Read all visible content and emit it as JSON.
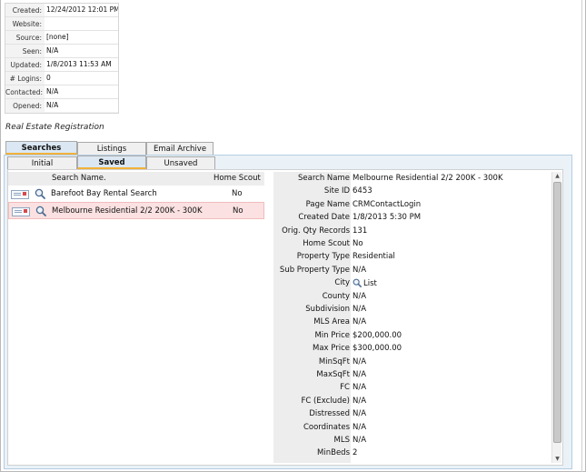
{
  "contact_info": [
    {
      "label": "Created:",
      "value": "12/24/2012 12:01 PM"
    },
    {
      "label": "Website:",
      "value": ""
    },
    {
      "label": "Source:",
      "value": "[none]"
    },
    {
      "label": "Seen:",
      "value": "N/A"
    },
    {
      "label": "Updated:",
      "value": "1/8/2013 11:53 AM"
    },
    {
      "label": "# Logins:",
      "value": "0"
    },
    {
      "label": "Contacted:",
      "value": "N/A"
    },
    {
      "label": "Opened:",
      "value": "N/A"
    }
  ],
  "section_title": "Real Estate Registration",
  "tabs": {
    "main": [
      "Searches",
      "Listings",
      "Email Archive"
    ],
    "active_main": "Searches",
    "sub": [
      "Initial",
      "Saved",
      "Unsaved"
    ],
    "active_sub": "Saved"
  },
  "searches_table": {
    "headers": [
      "Search Name.",
      "Home Scout"
    ],
    "rows": [
      {
        "name": "Barefoot Bay Rental Search",
        "home_scout": "No",
        "selected": false
      },
      {
        "name": "Melbourne Residential 2/2 200K - 300K",
        "home_scout": "No",
        "selected": true
      }
    ]
  },
  "details": [
    {
      "label": "Search Name",
      "value": "Melbourne Residential 2/2 200K - 300K"
    },
    {
      "label": "Site ID",
      "value": "6453"
    },
    {
      "label": "Page Name",
      "value": "CRMContactLogin"
    },
    {
      "label": "Created Date",
      "value": "1/8/2013 5:30 PM"
    },
    {
      "label": "Orig. Qty Records",
      "value": "131"
    },
    {
      "label": "Home Scout",
      "value": "No"
    },
    {
      "label": "Property Type",
      "value": "Residential"
    },
    {
      "label": "Sub Property Type",
      "value": "N/A"
    },
    {
      "label": "City",
      "value": "List"
    },
    {
      "label": "County",
      "value": "N/A"
    },
    {
      "label": "Subdivision",
      "value": "N/A"
    },
    {
      "label": "MLS Area",
      "value": "N/A"
    },
    {
      "label": "Min Price",
      "value": "$200,000.00"
    },
    {
      "label": "Max Price",
      "value": "$300,000.00"
    },
    {
      "label": "MinSqFt",
      "value": "N/A"
    },
    {
      "label": "MaxSqFt",
      "value": "N/A"
    },
    {
      "label": "FC",
      "value": "N/A"
    },
    {
      "label": "FC (Exclude)",
      "value": "N/A"
    },
    {
      "label": "Distressed",
      "value": "N/A"
    },
    {
      "label": "Coordinates",
      "value": "N/A"
    },
    {
      "label": "MLS",
      "value": "N/A"
    },
    {
      "label": "MinBeds",
      "value": "2"
    }
  ],
  "icons": {
    "search_icon": "magnifier-icon",
    "email_icon": "email-icon",
    "scroll_up": "scroll-up-arrow",
    "scroll_down": "scroll-down-arrow"
  },
  "colors": {
    "tab_active_bg": "#dbe8f3",
    "tab_active_underline": "#f2b13a",
    "selected_row": "#fbe1e1",
    "panel_bg": "#eaf2f8"
  }
}
